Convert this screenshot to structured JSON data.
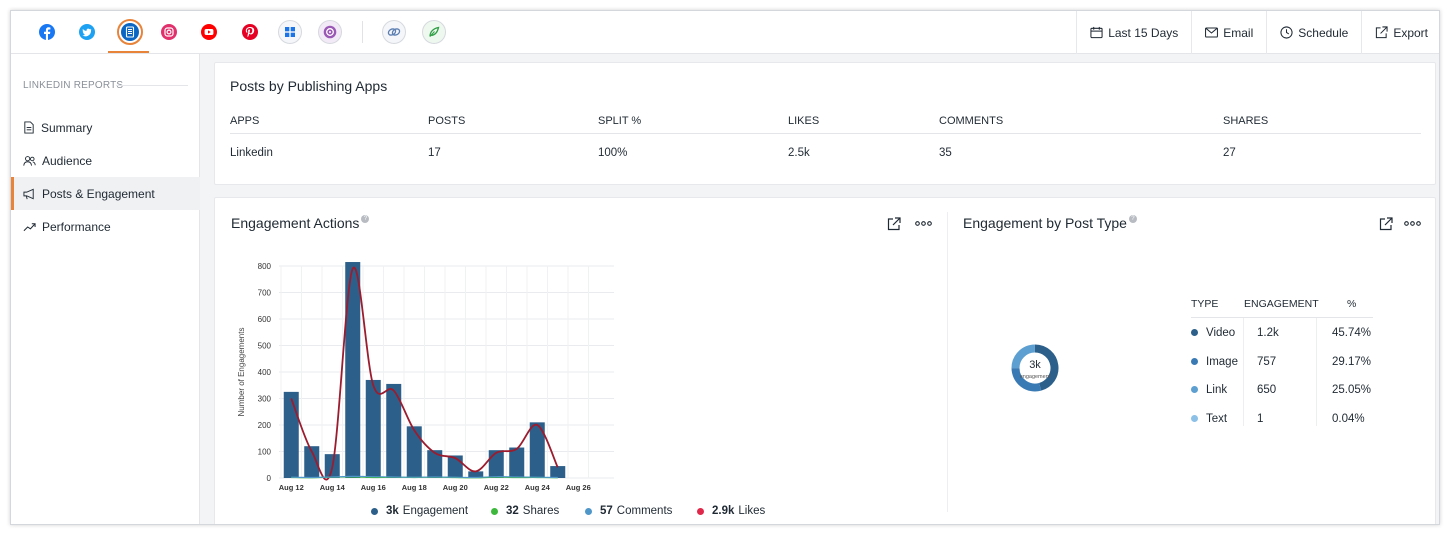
{
  "topbar": {
    "social_icons": [
      {
        "name": "facebook-icon",
        "color": "#1877f2"
      },
      {
        "name": "twitter-icon",
        "color": "#1da1f2"
      },
      {
        "name": "linkedin-icon",
        "color": "#0a66c2",
        "active": true
      },
      {
        "name": "instagram-icon",
        "color": "#e1306c"
      },
      {
        "name": "youtube-icon",
        "color": "#ff0000"
      },
      {
        "name": "pinterest-icon",
        "color": "#e60023"
      },
      {
        "name": "google-business-icon",
        "color": "#1a73e8"
      },
      {
        "name": "threads-icon",
        "color": "#9b59b6"
      },
      {
        "name": "link-icon",
        "color": "#5b7db1"
      },
      {
        "name": "leaf-icon",
        "color": "#2e9e44"
      }
    ],
    "actions": {
      "date_range": "Last 15 Days",
      "email": "Email",
      "schedule": "Schedule",
      "export": "Export"
    }
  },
  "sidebar": {
    "heading": "LINKEDIN REPORTS",
    "items": [
      {
        "label": "Summary",
        "icon": "document-icon"
      },
      {
        "label": "Audience",
        "icon": "users-icon"
      },
      {
        "label": "Posts & Engagement",
        "icon": "megaphone-icon",
        "active": true
      },
      {
        "label": "Performance",
        "icon": "trend-icon"
      }
    ]
  },
  "publishing": {
    "title": "Posts by Publishing Apps",
    "headers": [
      "APPS",
      "POSTS",
      "SPLIT %",
      "LIKES",
      "COMMENTS",
      "SHARES"
    ],
    "row": [
      "Linkedin",
      "17",
      "100%",
      "2.5k",
      "35",
      "27"
    ]
  },
  "engagement_actions": {
    "title": "Engagement Actions",
    "help": "?",
    "legend": [
      {
        "value": "3k",
        "label": "Engagement",
        "color": "#2c5f8a"
      },
      {
        "value": "32",
        "label": "Shares",
        "color": "#3db83d"
      },
      {
        "value": "57",
        "label": "Comments",
        "color": "#4f97c9"
      },
      {
        "value": "2.9k",
        "label": "Likes",
        "color": "#e0284a"
      }
    ]
  },
  "engagement_by_type": {
    "title": "Engagement by Post Type",
    "help": "?",
    "donut_value": "3k",
    "donut_label": "engagement",
    "headers": [
      "TYPE",
      "ENGAGEMENT",
      "%"
    ],
    "rows": [
      {
        "type": "Video",
        "engagement": "1.2k",
        "pct": "45.74%",
        "share": 45.74,
        "color": "#2c5f8a"
      },
      {
        "type": "Image",
        "engagement": "757",
        "pct": "29.17%",
        "share": 29.17,
        "color": "#3a7ab4"
      },
      {
        "type": "Link",
        "engagement": "650",
        "pct": "25.05%",
        "share": 25.05,
        "color": "#5d9fd0"
      },
      {
        "type": "Text",
        "engagement": "1",
        "pct": "0.04%",
        "share": 0.04,
        "color": "#8cc0e6"
      }
    ]
  },
  "chart_data": {
    "type": "bar",
    "ylabel": "Number of Engagements",
    "xlabel": "",
    "ylim": [
      0,
      800
    ],
    "yticks": [
      0,
      100,
      200,
      300,
      400,
      500,
      600,
      700,
      800
    ],
    "categories": [
      "Aug 12",
      "Aug 13",
      "Aug 14",
      "Aug 15",
      "Aug 16",
      "Aug 17",
      "Aug 18",
      "Aug 19",
      "Aug 20",
      "Aug 21",
      "Aug 22",
      "Aug 23",
      "Aug 24",
      "Aug 25"
    ],
    "xtick_labels": [
      "Aug 12",
      "Aug 14",
      "Aug 16",
      "Aug 18",
      "Aug 20",
      "Aug 22",
      "Aug 24",
      "Aug 26"
    ],
    "series": [
      {
        "name": "Engagement",
        "type": "bar",
        "color": "#2c5f8a",
        "values": [
          325,
          120,
          90,
          815,
          370,
          355,
          195,
          105,
          85,
          25,
          105,
          115,
          210,
          45
        ]
      },
      {
        "name": "Likes",
        "type": "line",
        "color": "#9b1c2e",
        "values": [
          300,
          100,
          40,
          790,
          350,
          330,
          180,
          95,
          75,
          25,
          95,
          110,
          200,
          40
        ]
      },
      {
        "name": "Shares",
        "type": "line",
        "color": "#3db83d",
        "values": [
          2,
          1,
          3,
          4,
          2,
          3,
          2,
          3,
          2,
          1,
          3,
          2,
          2,
          1
        ]
      },
      {
        "name": "Comments",
        "type": "line",
        "color": "#4f97c9",
        "values": [
          3,
          2,
          4,
          6,
          5,
          4,
          3,
          4,
          3,
          2,
          5,
          4,
          3,
          2
        ]
      }
    ],
    "grid": true
  }
}
